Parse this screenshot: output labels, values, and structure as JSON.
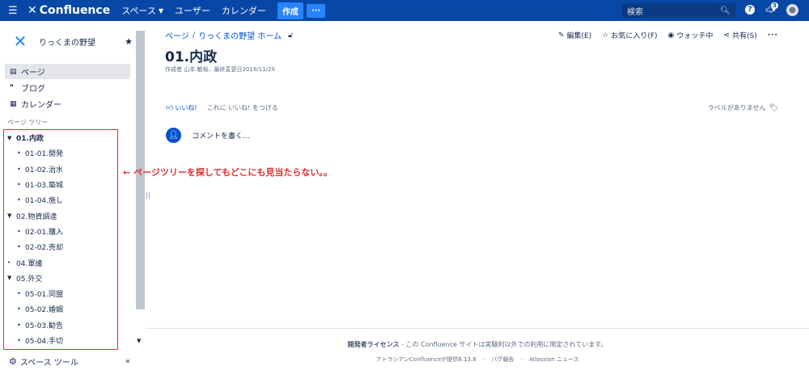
{
  "topnav": {
    "product": "Confluence",
    "items": [
      "スペース",
      "ユーザー",
      "カレンダー"
    ],
    "create": "作成",
    "more": "···",
    "search_placeholder": "検索",
    "notif_count": "3"
  },
  "sidebar": {
    "space_name": "りっくまの野望",
    "nav": [
      {
        "label": "ページ",
        "icon": "page-icon"
      },
      {
        "label": "ブログ",
        "icon": "quote-icon"
      },
      {
        "label": "カレンダー",
        "icon": "calendar-icon"
      }
    ],
    "tree_title": "ページ ツリー",
    "tree": [
      {
        "label": "01.内政",
        "level": 0,
        "expanded": true
      },
      {
        "label": "01-01.開発",
        "level": 1
      },
      {
        "label": "01-02.治水",
        "level": 1
      },
      {
        "label": "01-03.築城",
        "level": 1
      },
      {
        "label": "01-04.施し",
        "level": 1
      },
      {
        "label": "02.物資調達",
        "level": 0,
        "expanded": true
      },
      {
        "label": "02-01.購入",
        "level": 1
      },
      {
        "label": "02-02.売却",
        "level": 1
      },
      {
        "label": "04.軍議",
        "level": 0,
        "leaf": true
      },
      {
        "label": "05.外交",
        "level": 0,
        "expanded": true
      },
      {
        "label": "05-01.同盟",
        "level": 1
      },
      {
        "label": "05-02.婚姻",
        "level": 1
      },
      {
        "label": "05-03.勧告",
        "level": 1
      },
      {
        "label": "05-04.手切",
        "level": 1
      }
    ],
    "space_tools": "スペース ツール",
    "collapse": "«"
  },
  "main": {
    "breadcrumb": [
      "ページ",
      "りっくまの野望 ホーム"
    ],
    "actions": {
      "edit": "編集(E)",
      "favorite": "お気に入り(F)",
      "watch": "ウォッチ中",
      "share": "共有(S)",
      "more": "···"
    },
    "title": "01.内政",
    "byline": "作成者 山本 敏裕、最終変更日2019/11/29",
    "like": "いいね!",
    "like_hint": "これに いいね! をつける",
    "labels": "ラベルがありません",
    "comment_placeholder": "コメントを書く..."
  },
  "annotation": "← ページツリーを探してもどこにも見当たらない。。",
  "footer": {
    "license_bold": "開発者ライセンス",
    "license_rest": " - この Confluence サイトは実験利以外での利用に限定されています。",
    "powered": "アトラシアンConfluenceが提供6.13.8",
    "bug": "バグ報告",
    "news": "Atlassian ニュース"
  },
  "colors": {
    "nav_bg": "#0747a6",
    "accent": "#2684ff",
    "link": "#0052cc",
    "annotation": "#e03131"
  }
}
